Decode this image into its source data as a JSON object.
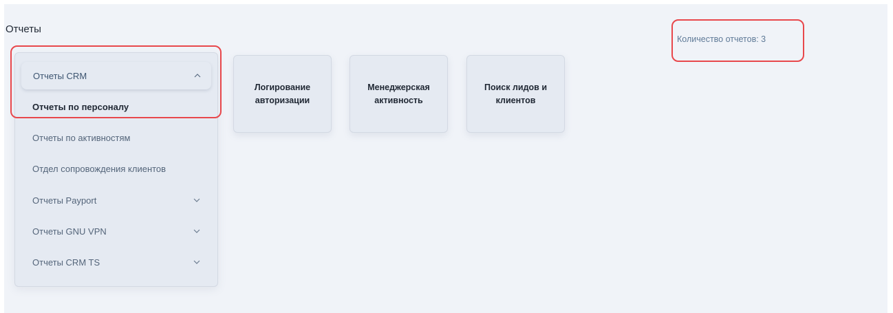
{
  "page": {
    "title": "Отчеты",
    "report_count": "Количество отчетов: 3"
  },
  "menu": {
    "header": "Отчеты CRM",
    "items": [
      {
        "label": "Отчеты по персоналу",
        "active": true,
        "has_children": false
      },
      {
        "label": "Отчеты по активностям",
        "active": false,
        "has_children": false
      },
      {
        "label": "Отдел сопровождения клиентов",
        "active": false,
        "has_children": false
      },
      {
        "label": "Отчеты Payport",
        "active": false,
        "has_children": true
      },
      {
        "label": "Отчеты GNU VPN",
        "active": false,
        "has_children": true
      },
      {
        "label": "Отчеты CRM TS",
        "active": false,
        "has_children": true
      }
    ]
  },
  "cards": [
    {
      "label": "Логирование\nавторизации"
    },
    {
      "label": "Менеджерская\nактивность"
    },
    {
      "label": "Поиск лидов и\nклиентов"
    }
  ],
  "colors": {
    "background": "#f0f3f8",
    "card": "#e5eaf2",
    "highlight": "#e8474b"
  }
}
